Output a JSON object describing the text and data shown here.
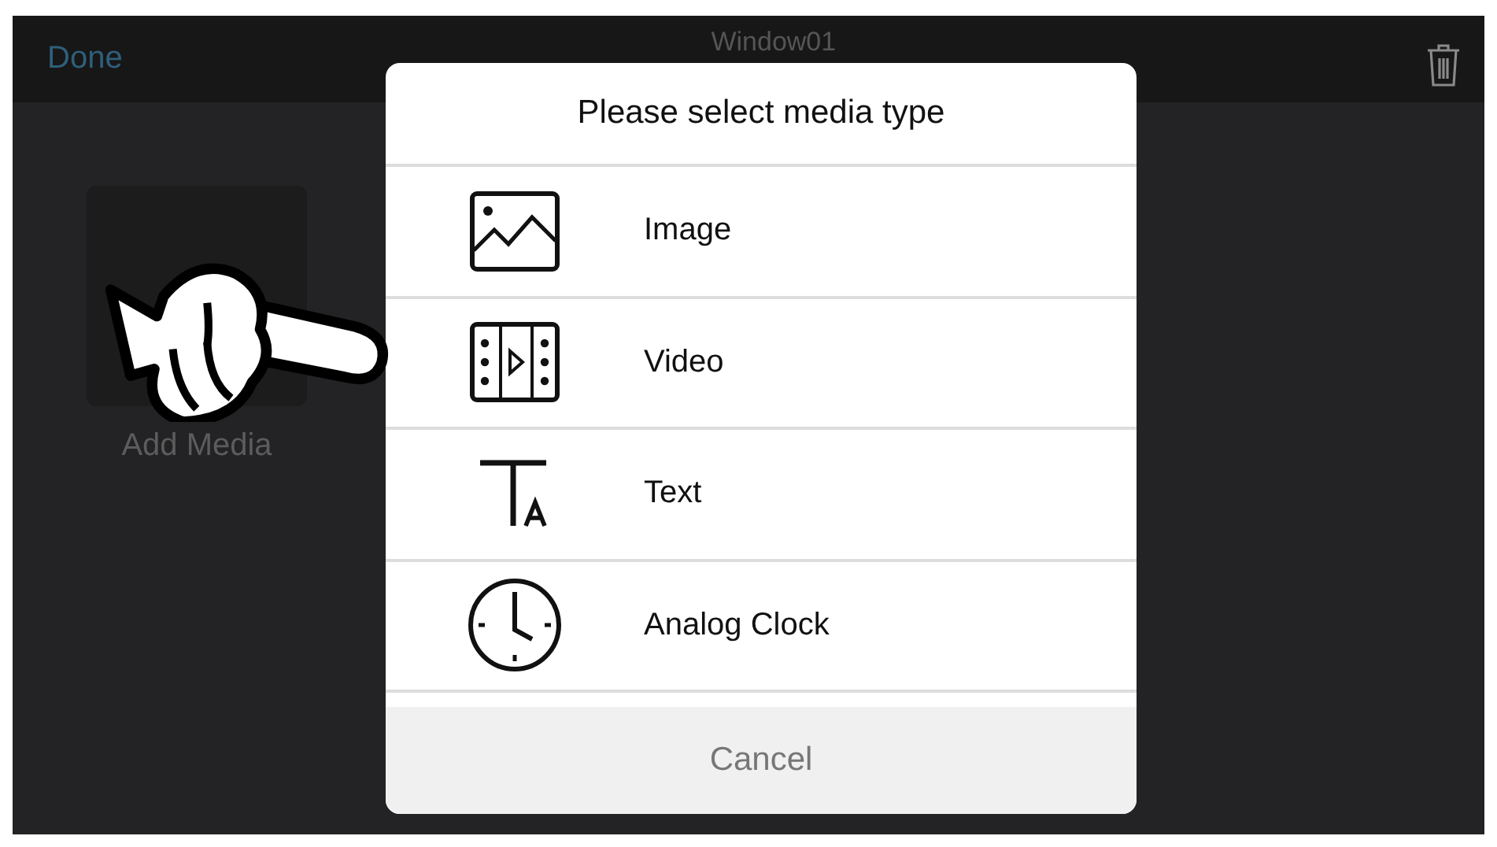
{
  "top_bar": {
    "done": "Done",
    "title": "Window01"
  },
  "add_media": {
    "label": "Add Media"
  },
  "dialog": {
    "title": "Please select media type",
    "items": [
      {
        "kind": "image",
        "label": "Image"
      },
      {
        "kind": "video",
        "label": "Video"
      },
      {
        "kind": "text",
        "label": "Text"
      },
      {
        "kind": "clock",
        "label": "Analog Clock"
      }
    ],
    "cancel": "Cancel"
  }
}
